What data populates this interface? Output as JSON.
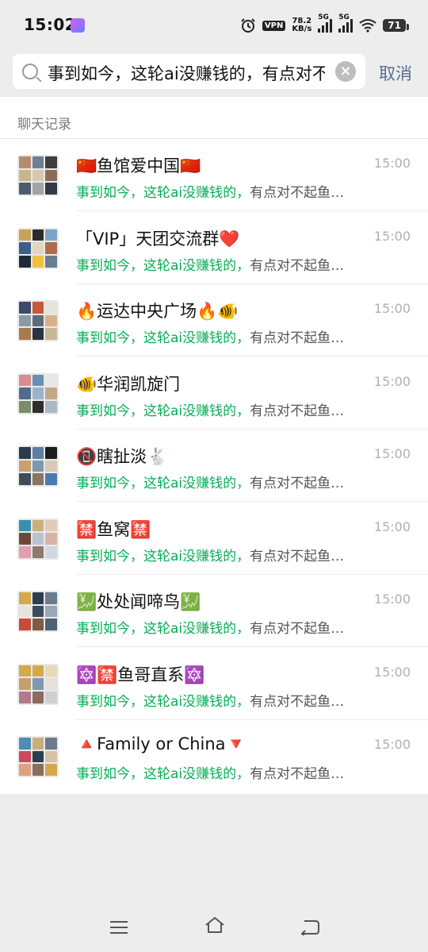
{
  "status_bar": {
    "time": "15:02",
    "vpn": "VPN",
    "speed_value": "78.2",
    "speed_unit": "KB/s",
    "sim1": "5G",
    "sim2": "5G",
    "battery": "71"
  },
  "search": {
    "query": "事到如今，这轮ai没赚钱的，有点对不起鱼",
    "cancel_label": "取消"
  },
  "section_title": "聊天记录",
  "highlight_color": "#06ae56",
  "results": [
    {
      "name": "🇨🇳鱼馆爱中国🇨🇳",
      "time": "15:00",
      "snippet_highlight": "事到如今，这轮ai没赚钱的，",
      "snippet_rest": "有点对不起鱼…",
      "avatar_colors": [
        "#b58c6b",
        "#6e7f96",
        "#3e3e3e",
        "#c9b48a",
        "#d9c8b0",
        "#8a6d5a",
        "#4d5d6e",
        "#a3a3a3",
        "#2f3a44"
      ]
    },
    {
      "name": "「VIP」天团交流群❤️",
      "time": "15:00",
      "snippet_highlight": "事到如今，这轮ai没赚钱的，",
      "snippet_rest": "有点对不起鱼…",
      "avatar_colors": [
        "#c9a25a",
        "#2c2c2c",
        "#7fa4c7",
        "#3a5f8a",
        "#e0d6c2",
        "#b06b4a",
        "#1e2a38",
        "#f0c040",
        "#6a7d8c"
      ]
    },
    {
      "name": "🔥运达中央广场🔥🐠",
      "time": "15:00",
      "snippet_highlight": "事到如今，这轮ai没赚钱的，",
      "snippet_rest": "有点对不起鱼…",
      "avatar_colors": [
        "#3b4a6b",
        "#c9573a",
        "#e6e2dc",
        "#8c9aa8",
        "#5d6c7a",
        "#d9b08c",
        "#a87b4f",
        "#2a3442",
        "#c7b89a"
      ]
    },
    {
      "name": "🐠华润凯旋门",
      "time": "15:00",
      "snippet_highlight": "事到如今，这轮ai没赚钱的，",
      "snippet_rest": "有点对不起鱼…",
      "avatar_colors": [
        "#d98c8c",
        "#6a8fb3",
        "#e8e8e8",
        "#4f6e8f",
        "#9bb3c9",
        "#c2a886",
        "#7a8c6b",
        "#2e2e2e",
        "#a9b8c4"
      ]
    },
    {
      "name": "📵瞎扯淡🐇",
      "time": "15:00",
      "snippet_highlight": "事到如今，这轮ai没赚钱的，",
      "snippet_rest": "有点对不起鱼…",
      "avatar_colors": [
        "#2b3a4d",
        "#5e7fa3",
        "#1d1d1d",
        "#c7a06b",
        "#7f98b2",
        "#d8c8b4",
        "#3d4d5c",
        "#8a7560",
        "#4a7bb0"
      ]
    },
    {
      "name": "🈲鱼窝🈲",
      "time": "15:00",
      "snippet_highlight": "事到如今，这轮ai没赚钱的，",
      "snippet_rest": "有点对不起鱼…",
      "avatar_colors": [
        "#3a8fb0",
        "#c9b07a",
        "#e2c9b8",
        "#6b4a3a",
        "#b8c4d0",
        "#d7b3a6",
        "#e0a0b0",
        "#8c7a6a",
        "#cfd8df"
      ]
    },
    {
      "name": "💹处处闻啼鸟💹",
      "time": "15:00",
      "snippet_highlight": "事到如今，这轮ai没赚钱的，",
      "snippet_rest": "有点对不起鱼…",
      "avatar_colors": [
        "#d4a84b",
        "#2d3e50",
        "#6a7b8c",
        "#e8e4dc",
        "#3b4c5d",
        "#9aa8b6",
        "#c94a3a",
        "#7a5d44",
        "#4e6277"
      ]
    },
    {
      "name": "🔯🈲鱼哥直系🔯",
      "time": "15:00",
      "snippet_highlight": "事到如今，这轮ai没赚钱的，",
      "snippet_rest": "有点对不起鱼…",
      "avatar_colors": [
        "#d4a84b",
        "#d4a84b",
        "#e8d9b8",
        "#c4a070",
        "#7f98b2",
        "#e6e0d8",
        "#b07a8c",
        "#8c6b5a",
        "#cfcfcf"
      ]
    },
    {
      "name": "🔺Family or China🔻",
      "time": "15:00",
      "snippet_highlight": "事到如今，这轮ai没赚钱的，",
      "snippet_rest": "有点对不起鱼…",
      "avatar_colors": [
        "#4a8fb8",
        "#c9b07a",
        "#6b7b8b",
        "#c94a5a",
        "#2c3e50",
        "#d7c4a4",
        "#e0a080",
        "#8a6d5a",
        "#d4a84b"
      ]
    }
  ],
  "nav": {
    "menu_icon": "menu-icon",
    "home_icon": "home-icon",
    "back_icon": "back-icon"
  }
}
